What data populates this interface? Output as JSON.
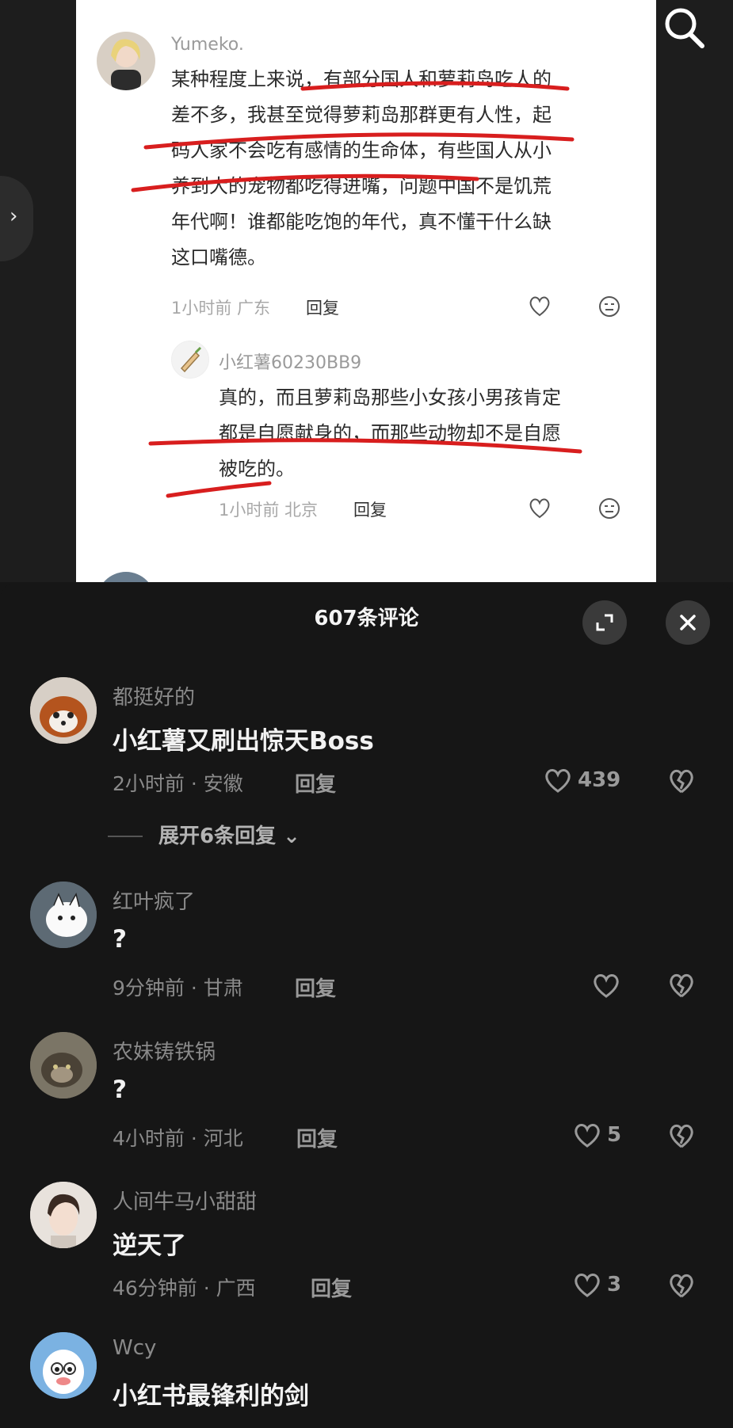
{
  "screenshot": {
    "comment": {
      "username": "Yumeko.",
      "lines": [
        "某种程度上来说，有部分国人和萝莉岛吃人的",
        "差不多，我甚至觉得萝莉岛那群更有人性，起",
        "码人家不会吃有感情的生命体，有些国人从小",
        "养到大的宠物都吃得进嘴，问题中国不是饥荒",
        "年代啊！谁都能吃饱的年代，真不懂干什么缺",
        "这口嘴德。"
      ],
      "meta": "1小时前 广东",
      "reply_label": "回复"
    },
    "reply": {
      "username": "小红薯60230BB9",
      "lines": [
        "真的，而且萝莉岛那些小女孩小男孩肯定",
        "都是自愿献身的，而那些动物却不是自愿",
        "被吃的。"
      ],
      "meta": "1小时前 北京",
      "reply_label": "回复"
    },
    "annotation_color": "#d81e1e"
  },
  "sheet": {
    "title": "607条评论",
    "expand_icon": "expand-icon",
    "close_icon": "close-icon"
  },
  "comments": [
    {
      "username": "都挺好的",
      "text": "小红薯又刷出惊天Boss",
      "meta": "2小时前 · 安徽",
      "reply_label": "回复",
      "likes": "439",
      "avatar": "red-panda"
    },
    {
      "username": "红叶疯了",
      "text": "?",
      "meta": "9分钟前 · 甘肃",
      "reply_label": "回复",
      "likes": "",
      "avatar": "cartoon-cat"
    },
    {
      "username": "农妹铸铁锅",
      "text": "?",
      "meta": "4小时前 · 河北",
      "reply_label": "回复",
      "likes": "5",
      "avatar": "cat-photo"
    },
    {
      "username": "人间牛马小甜甜",
      "text": "逆天了",
      "meta": "46分钟前 · 广西",
      "reply_label": "回复",
      "likes": "3",
      "avatar": "anime-boy"
    },
    {
      "username": "Wcy",
      "text": "小红书最锋利的剑",
      "meta": "",
      "reply_label": "",
      "likes": "",
      "avatar": "cartoon-goat"
    }
  ],
  "expand_replies": "展开6条回复",
  "colors": {
    "sheet_bg": "#161616",
    "text_primary": "#f2f2f2",
    "text_secondary": "#8a8a8a"
  }
}
